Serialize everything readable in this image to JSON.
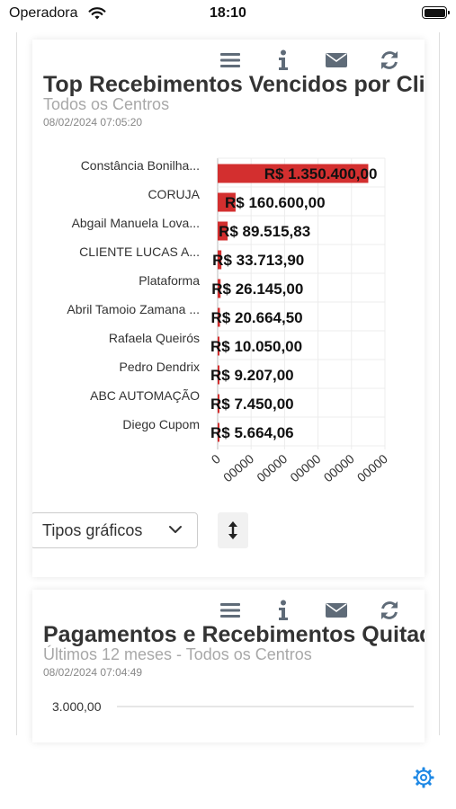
{
  "status_bar": {
    "carrier": "Operadora",
    "time": "18:10",
    "battery_level": 1.0
  },
  "cards": [
    {
      "title": "Top Recebimentos Vencidos por Clie",
      "subtitle": "Todos os Centros",
      "timestamp": "08/02/2024 07:05:20",
      "toolbar_icons": [
        "menu-icon",
        "info-icon",
        "mail-icon",
        "refresh-icon"
      ],
      "chart_data": {
        "type": "bar",
        "orientation": "horizontal",
        "bar_color": "#d32f2f",
        "categories": [
          "Constância Bonilha...",
          "CORUJA",
          "Abgail Manuela Lova...",
          "CLIENTE LUCAS A...",
          "Plataforma",
          "Abril Tamoio Zamana ...",
          "Rafaela Queirós",
          "Pedro Dendrix",
          "ABC AUTOMAÇÃO",
          "Diego Cupom"
        ],
        "values": [
          1350400.0,
          160600.0,
          89515.83,
          33713.9,
          26145.0,
          20664.5,
          10050.0,
          9207.0,
          7450.0,
          5664.06
        ],
        "data_labels": [
          "R$ 1.350.400,00",
          "R$ 160.600,00",
          "R$ 89.515,83",
          "R$ 33.713,90",
          "R$ 26.145,00",
          "R$ 20.664,50",
          "R$ 10.050,00",
          "R$ 9.207,00",
          "R$ 7.450,00",
          "R$ 5.664,06"
        ],
        "xlim": [
          0,
          1500000
        ],
        "x_ticks": [
          "0",
          "00000",
          "00000",
          "00000",
          "00000",
          "00000"
        ],
        "grid": true
      },
      "chart_type_select": "Tipos gráficos"
    },
    {
      "title": "Pagamentos e Recebimentos Quitado",
      "subtitle": "Últimos 12 meses - Todos os Centros",
      "timestamp": "08/02/2024 07:04:49",
      "toolbar_icons": [
        "menu-icon",
        "info-icon",
        "mail-icon",
        "refresh-icon"
      ],
      "chart_data": {
        "type": "bar",
        "y_ticks": [
          "3.000,00"
        ],
        "grid": true
      }
    }
  ],
  "bottom_icon": "gear-icon"
}
